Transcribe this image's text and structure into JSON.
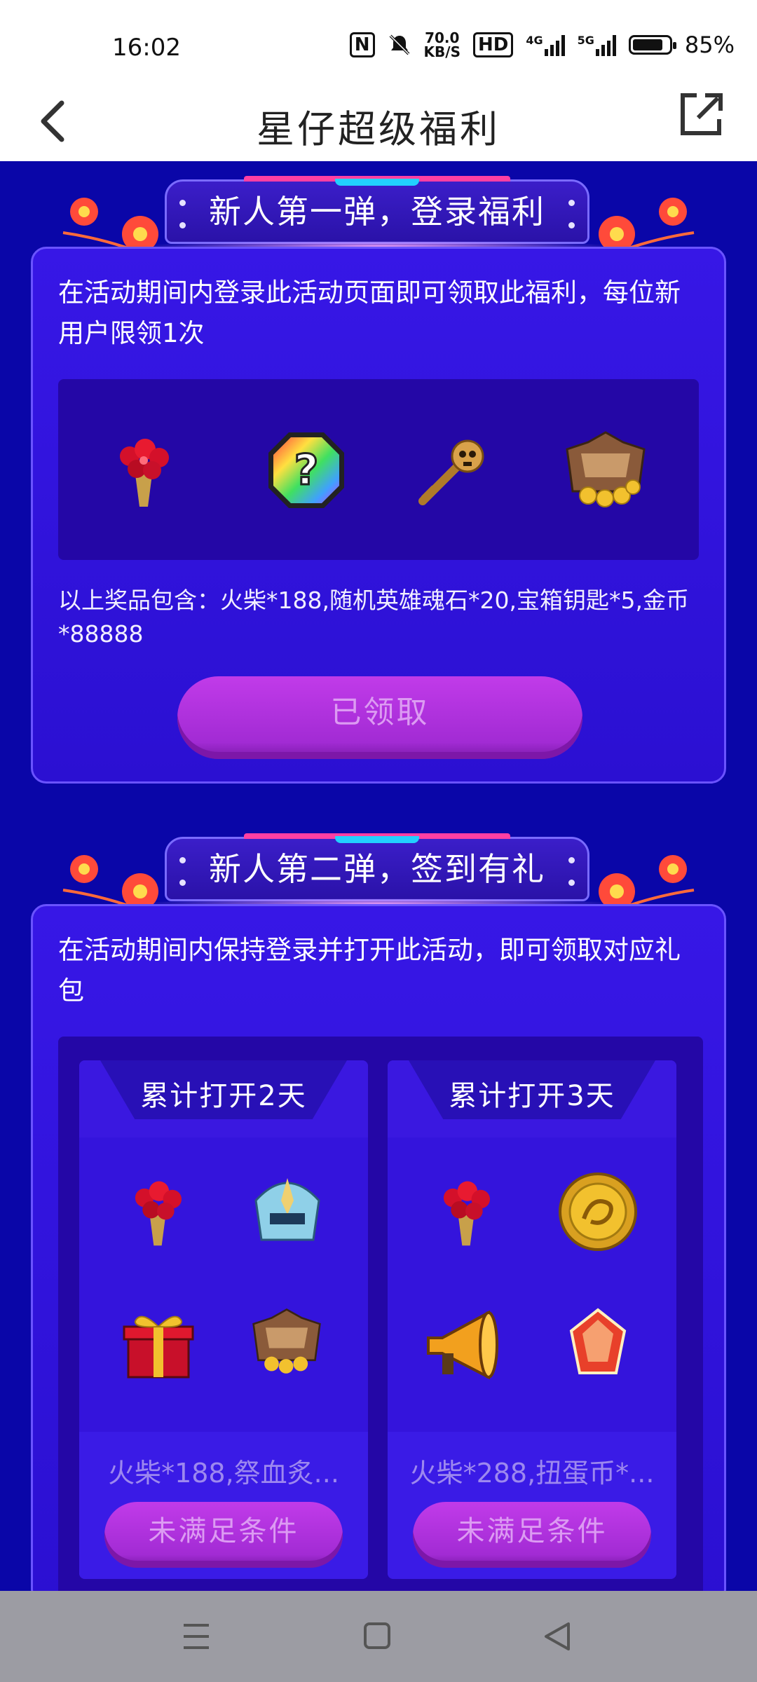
{
  "status_bar": {
    "time": "16:02",
    "nfc_icon": "N",
    "speed_value": "70.0",
    "speed_unit": "KB/S",
    "hd_label": "HD",
    "net_4g": "4G",
    "net_5g": "5G",
    "battery_percent_text": "85%",
    "battery_level": 0.85
  },
  "header": {
    "title": "星仔超级福利"
  },
  "section1": {
    "banner_title": "新人第一弹，登录福利",
    "description": "在活动期间内登录此活动页面即可领取此福利，每位新用户限领1次",
    "prizes": [
      "flower-bouquet-icon",
      "random-hero-soulstone-icon",
      "chest-key-icon",
      "gold-coin-chest-icon"
    ],
    "prize_note": "以上奖品包含：火柴*188,随机英雄魂石*20,宝箱钥匙*5,金币*88888",
    "button_label": "已领取"
  },
  "section2": {
    "banner_title": "新人第二弹，签到有礼",
    "description": "在活动期间内保持登录并打开此活动，即可领取对应礼包",
    "days": [
      {
        "title": "累计打开2天",
        "items": [
          "flower-bouquet-icon",
          "helmet-skin-icon",
          "gift-box-icon",
          "gold-coin-chest-icon"
        ],
        "note": "火柴*188,祭血炙...",
        "button_label": "未满足条件"
      },
      {
        "title": "累计打开3天",
        "items": [
          "flower-bouquet-icon",
          "gacha-coin-icon",
          "megaphone-icon",
          "crystal-gem-icon"
        ],
        "note": "火柴*288,扭蛋币*...",
        "button_label": "未满足条件"
      }
    ]
  },
  "colors": {
    "page_bg": "#0a06a8",
    "card_bg": "#3717e6",
    "button_bg": "#b533e0",
    "button_text": "#dc9bf2"
  },
  "nav": {
    "buttons": [
      "menu-icon",
      "home-icon",
      "back-triangle-icon"
    ]
  }
}
